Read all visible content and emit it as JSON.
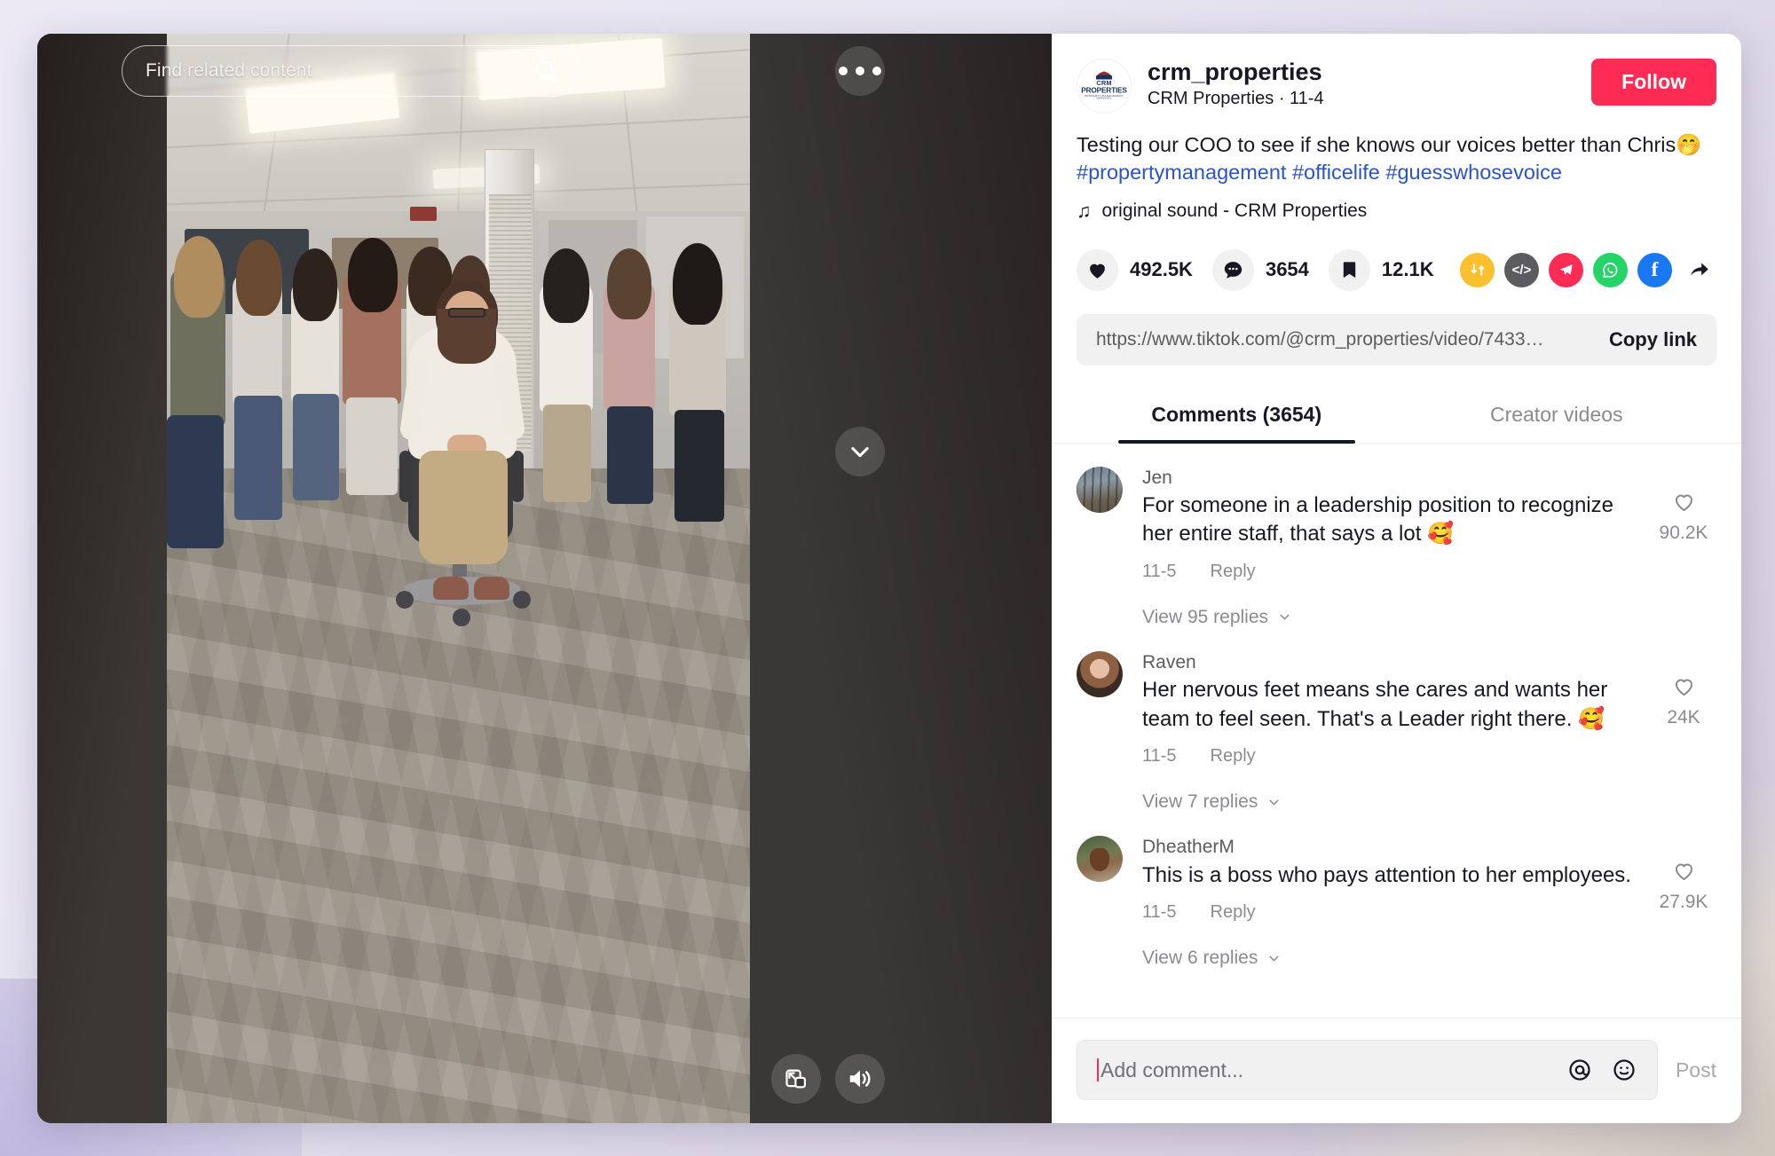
{
  "video": {
    "search_placeholder": "Find related content",
    "search_icon": "search-icon",
    "more_icon": "more-options-icon",
    "next_icon": "chevron-down-icon",
    "pip_icon": "picture-in-picture-icon",
    "volume_icon": "volume-on-icon"
  },
  "author": {
    "username": "crm_properties",
    "display_line": "CRM Properties · 11-4",
    "follow_label": "Follow",
    "avatar_name": "crm-properties-logo",
    "logo_line1": "CRM",
    "logo_line2": "PROPERTIES",
    "logo_line3": "PROPERTY MANAGEMENT SERVICES"
  },
  "post": {
    "caption_text": "Testing our COO to see if she knows our voices better than Chris",
    "caption_emoji": "🤭",
    "hashtags": [
      "#propertymanagement",
      "#officelife",
      "#guesswhosevoice"
    ],
    "music_icon": "music-note-icon",
    "music_label": "original sound - CRM Properties"
  },
  "actions": {
    "like_count": "492.5K",
    "comment_count": "3654",
    "bookmark_count": "12.1K",
    "like_icon": "heart-filled-icon",
    "comment_icon": "comment-bubble-icon",
    "bookmark_icon": "bookmark-filled-icon",
    "share_icons": [
      {
        "name": "repost-icon",
        "glyph": "⇅",
        "color": "#fbc02d"
      },
      {
        "name": "embed-code-icon",
        "glyph": "</>",
        "color": "#5b5b60"
      },
      {
        "name": "telegram-icon",
        "glyph": "➤",
        "color": "#fe2c55"
      },
      {
        "name": "whatsapp-icon",
        "glyph": "",
        "color": "#25d366"
      },
      {
        "name": "facebook-icon",
        "glyph": "f",
        "color": "#1877f2"
      },
      {
        "name": "share-arrow-icon",
        "glyph": "➦",
        "color": "#161823"
      }
    ]
  },
  "copy": {
    "url": "https://www.tiktok.com/@crm_properties/video/7433…",
    "button_label": "Copy link"
  },
  "tabs": [
    {
      "label": "Comments (3654)",
      "active": true
    },
    {
      "label": "Creator videos",
      "active": false
    }
  ],
  "comments": [
    {
      "name": "Jen",
      "text": "For someone in a leadership position to recognize her entire staff, that says a lot 🥰",
      "date": "11-5",
      "reply_label": "Reply",
      "replies_label": "View 95 replies",
      "like_count": "90.2K",
      "avatar_name": "commenter-avatar-jen"
    },
    {
      "name": "Raven",
      "text": "Her nervous feet means she cares and wants her team to feel seen. That's a Leader right there. 🥰",
      "date": "11-5",
      "reply_label": "Reply",
      "replies_label": "View 7 replies",
      "like_count": "24K",
      "avatar_name": "commenter-avatar-raven"
    },
    {
      "name": "DheatherM",
      "text": "This is a boss who pays attention to her employees.",
      "date": "11-5",
      "reply_label": "Reply",
      "replies_label": "View 6 replies",
      "like_count": "27.9K",
      "avatar_name": "commenter-avatar-dheatherm"
    }
  ],
  "composer": {
    "placeholder": "Add comment...",
    "mention_icon": "at-mention-icon",
    "emoji_icon": "emoji-icon",
    "post_label": "Post"
  },
  "colors": {
    "brand_red": "#fe2c55",
    "link_blue": "#2b54c6",
    "text_primary": "#161823",
    "text_secondary": "#8a8b91"
  }
}
